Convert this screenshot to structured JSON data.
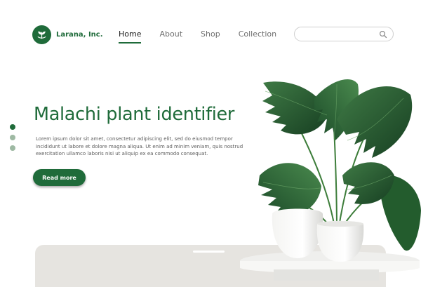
{
  "brand": {
    "name": "Larana, Inc.",
    "logo_icon": "leaf-icon",
    "color": "#1f6b3a"
  },
  "nav": {
    "items": [
      {
        "label": "Home",
        "active": true
      },
      {
        "label": "About",
        "active": false
      },
      {
        "label": "Shop",
        "active": false
      },
      {
        "label": "Collection",
        "active": false
      }
    ]
  },
  "search": {
    "value": "",
    "placeholder": "",
    "icon": "search-icon"
  },
  "carousel": {
    "dot_count": 3,
    "active_index": 0,
    "colors": {
      "active": "#1f6b3a",
      "inactive": "#9eb9a3"
    }
  },
  "hero": {
    "title": "Malachi plant identifier",
    "body": "Lorem ipsum dolor sit amet, consectetur adipiscing elit, sed do eiusmod tempor incididunt ut labore et dolore magna aliqua. Ut enim ad minim veniam, quis nostrud exercitation ullamco laboris nisi ut aliquip ex ea commodo consequat.",
    "cta_label": "Read more"
  },
  "image": {
    "subject": "monstera-plant-in-white-pots"
  }
}
